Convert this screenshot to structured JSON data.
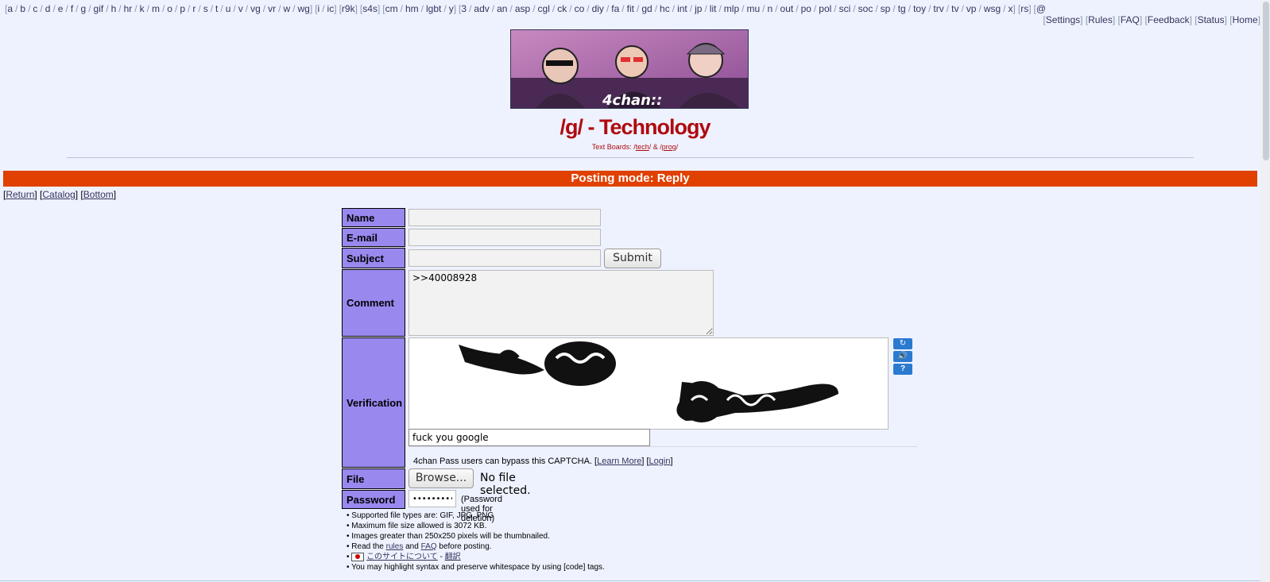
{
  "boardnav": {
    "groups": [
      [
        "a",
        "b",
        "c",
        "d",
        "e",
        "f",
        "g",
        "gif",
        "h",
        "hr",
        "k",
        "m",
        "o",
        "p",
        "r",
        "s",
        "t",
        "u",
        "v",
        "vg",
        "vr",
        "w",
        "wg"
      ],
      [
        "i",
        "ic"
      ],
      [
        "r9k"
      ],
      [
        "s4s"
      ],
      [
        "cm",
        "hm",
        "lgbt",
        "y"
      ],
      [
        "3",
        "adv",
        "an",
        "asp",
        "cgl",
        "ck",
        "co",
        "diy",
        "fa",
        "fit",
        "gd",
        "hc",
        "int",
        "jp",
        "lit",
        "mlp",
        "mu",
        "n",
        "out",
        "po",
        "pol",
        "sci",
        "soc",
        "sp",
        "tg",
        "toy",
        "trv",
        "tv",
        "vp",
        "wsg",
        "x"
      ],
      [
        "rs"
      ],
      [
        "@"
      ]
    ]
  },
  "toplinks": [
    "Settings",
    "Rules",
    "FAQ",
    "Feedback",
    "Status",
    "Home"
  ],
  "banner": {
    "caption": "4chan::"
  },
  "board": {
    "title": "/g/ - Technology",
    "textboards_prefix": "Text Boards: /",
    "tech": "tech",
    "amp": "/ & /",
    "prog": "prog",
    "suffix": "/"
  },
  "posting_mode": "Posting mode: Reply",
  "nav": {
    "return": "Return",
    "catalog": "Catalog",
    "bottom": "Bottom"
  },
  "form": {
    "name_label": "Name",
    "email_label": "E-mail",
    "subject_label": "Subject",
    "submit_label": "Submit",
    "comment_label": "Comment",
    "comment_value": ">>40008928",
    "verification_label": "Verification",
    "captcha_response": "fuck you google",
    "captcha_buttons": {
      "reload": "↻",
      "audio": "🔊",
      "help": "?"
    },
    "pass_note_prefix": "4chan Pass users can bypass this CAPTCHA. [",
    "learn_more": "Learn More",
    "pass_mid": "] [",
    "login": "Login",
    "pass_suffix": "]",
    "file_label": "File",
    "browse_label": "Browse...",
    "no_file": "No file selected.",
    "password_label": "Password",
    "password_value": "••••••••••",
    "password_note": "(Password used for deletion)"
  },
  "notes": {
    "types": "Supported file types are: GIF, JPG, PNG",
    "maxsize": "Maximum file size allowed is 3072 KB.",
    "thumb": "Images greater than 250x250 pixels will be thumbnailed.",
    "read_prefix": "Read the ",
    "rules": "rules",
    "and": " and ",
    "faq": "FAQ",
    "read_suffix": " before posting.",
    "jp_link": "このサイトについて",
    "jp_sep": " - ",
    "jp_trans": "翻訳",
    "code": "You may highlight syntax and preserve whitespace by using [code] tags."
  },
  "colors": {
    "title": "#af0a0f",
    "postmode_bg": "#e04000",
    "label_bg": "#9988ee",
    "page_bg": "#eef2ff"
  }
}
